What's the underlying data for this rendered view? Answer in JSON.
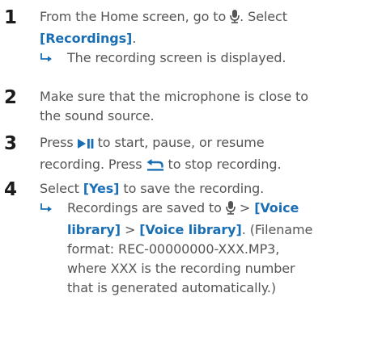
{
  "colors": {
    "text": "#555555",
    "step_number": "#1c1c1c",
    "accent": "#1a6fb4"
  },
  "steps": [
    {
      "number": "1",
      "l1_pre": "From the Home screen, go to",
      "l1_post": ". Select",
      "l2_key": "[Recordings]",
      "l2_post": ".",
      "result": "The recording screen is displayed."
    },
    {
      "number": "2",
      "l1": "Make sure that the microphone is close to",
      "l2": "the sound source."
    },
    {
      "number": "3",
      "l1_pre": "Press",
      "l1_post": "to start, pause, or resume",
      "l2_pre": "recording. Press",
      "l2_post": "to stop recording."
    },
    {
      "number": "4",
      "l1_pre": "Select",
      "l1_key": "[Yes]",
      "l1_post": "to save the recording.",
      "result_l1_pre": "Recordings are saved to",
      "result_l1_sep": ">",
      "result_l1_key": "[Voice",
      "result_l2_key": "library]",
      "result_l2_sep": ">",
      "result_l2_key2": "[Voice library]",
      "result_l2_post": ". (Filename",
      "result_l3": "format: REC-00000000-XXX.MP3,",
      "result_l4": "where XXX is the recording number",
      "result_l5": "that is generated automatically.)"
    }
  ],
  "icons": {
    "mic": "microphone-icon",
    "play_pause": "play-pause-icon",
    "back": "back-arrow-icon",
    "result_arrow": "result-arrow-icon"
  }
}
